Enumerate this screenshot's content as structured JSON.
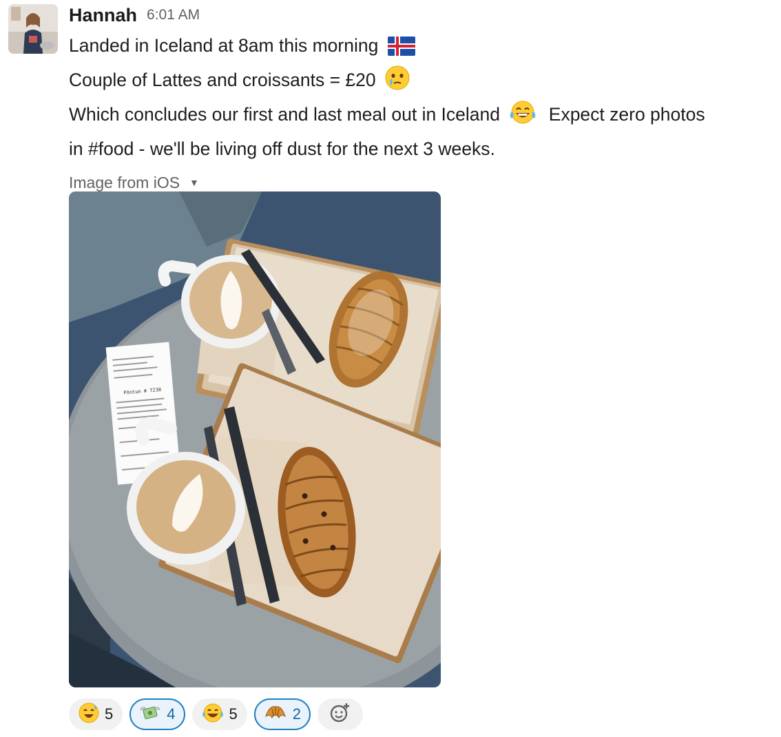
{
  "message": {
    "author": "Hannah",
    "time": "6:01 AM",
    "lines": [
      "Landed in Iceland at 8am this morning",
      "Couple of Lattes and croissants = £20",
      "Which concludes our first and last meal out in Iceland",
      "Expect zero photos",
      "in #food - we'll be living off dust for the next 3 weeks."
    ],
    "emojis": [
      "iceland-flag-icon",
      "face-holding-back-tears-icon",
      "tears-of-joy-icon"
    ]
  },
  "attachment": {
    "label": "Image from iOS",
    "receipt_order": "Pöntun # 7238"
  },
  "reactions": [
    {
      "icon": "sweat-smile-icon",
      "count": "5",
      "own": false
    },
    {
      "icon": "money-with-wings-icon",
      "count": "4",
      "own": true
    },
    {
      "icon": "tears-of-joy-icon",
      "count": "5",
      "own": false
    },
    {
      "icon": "croissant-icon",
      "count": "2",
      "own": true
    }
  ],
  "colors": {
    "own_reaction_border": "#1d7ec0",
    "own_reaction_bg": "#eaf3fb",
    "reaction_bg": "#f1f1f1",
    "secondary_text": "#616061"
  }
}
